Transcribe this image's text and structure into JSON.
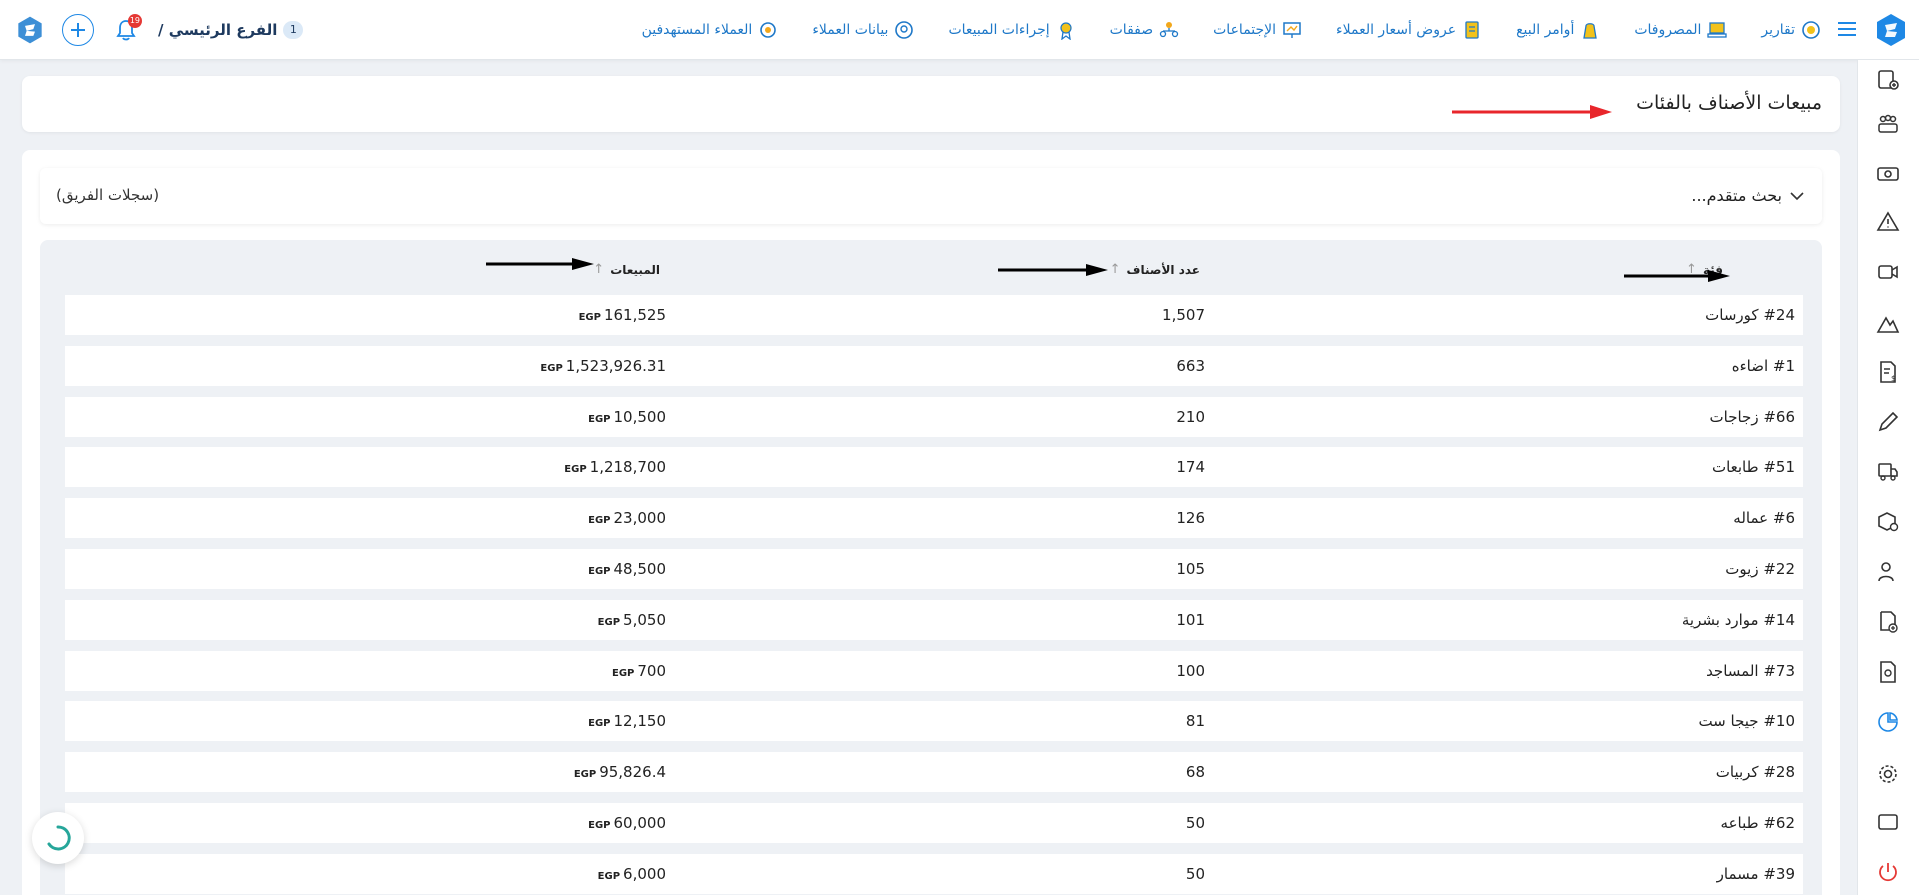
{
  "topbar": {
    "nav": [
      {
        "label": "العملاء المستهدفين",
        "icon": "target-customers-icon"
      },
      {
        "label": "بيانات العملاء",
        "icon": "customer-data-icon"
      },
      {
        "label": "إجراءات المبيعات",
        "icon": "sales-actions-icon"
      },
      {
        "label": "صفقات",
        "icon": "deals-icon"
      },
      {
        "label": "الإجتماعات",
        "icon": "meetings-icon"
      },
      {
        "label": "عروض أسعار العملاء",
        "icon": "quotes-icon"
      },
      {
        "label": "أوامر البيع",
        "icon": "sales-orders-icon"
      },
      {
        "label": "المصروفات",
        "icon": "expenses-icon"
      },
      {
        "label": "تقارير",
        "icon": "reports-icon"
      }
    ],
    "branch_label": "الفرع الرئيسي /",
    "branch_number": "1",
    "notification_count": "19"
  },
  "page": {
    "title": "مبيعات الأصناف بالفئات",
    "advanced_search": "بحث متقدم...",
    "team_records": "(سجلات الفريق)"
  },
  "table": {
    "headers": {
      "category": "فئة",
      "count": "عدد الأصناف",
      "sales": "المبيعات"
    },
    "currency": "EGP",
    "rows": [
      {
        "category": "#24 كورسات",
        "count": "1,507",
        "sales": "161,525"
      },
      {
        "category": "#1 اضاءه",
        "count": "663",
        "sales": "1,523,926.31"
      },
      {
        "category": "#66 زجاجات",
        "count": "210",
        "sales": "10,500"
      },
      {
        "category": "#51 طابعات",
        "count": "174",
        "sales": "1,218,700"
      },
      {
        "category": "#6 عماله",
        "count": "126",
        "sales": "23,000"
      },
      {
        "category": "#22 زيوت",
        "count": "105",
        "sales": "48,500"
      },
      {
        "category": "#14 موارد بشرية",
        "count": "101",
        "sales": "5,050"
      },
      {
        "category": "#73 المساجد",
        "count": "100",
        "sales": "700"
      },
      {
        "category": "#10 جيجا ست",
        "count": "81",
        "sales": "12,150"
      },
      {
        "category": "#28 كربيات",
        "count": "68",
        "sales": "95,826.4"
      },
      {
        "category": "#62 طباعه",
        "count": "50",
        "sales": "60,000"
      },
      {
        "category": "#39 مسمار",
        "count": "50",
        "sales": "6,000"
      }
    ]
  },
  "colors": {
    "accent": "#1e88e5",
    "annotation_red": "#e8262b",
    "annotation_black": "#000000"
  }
}
